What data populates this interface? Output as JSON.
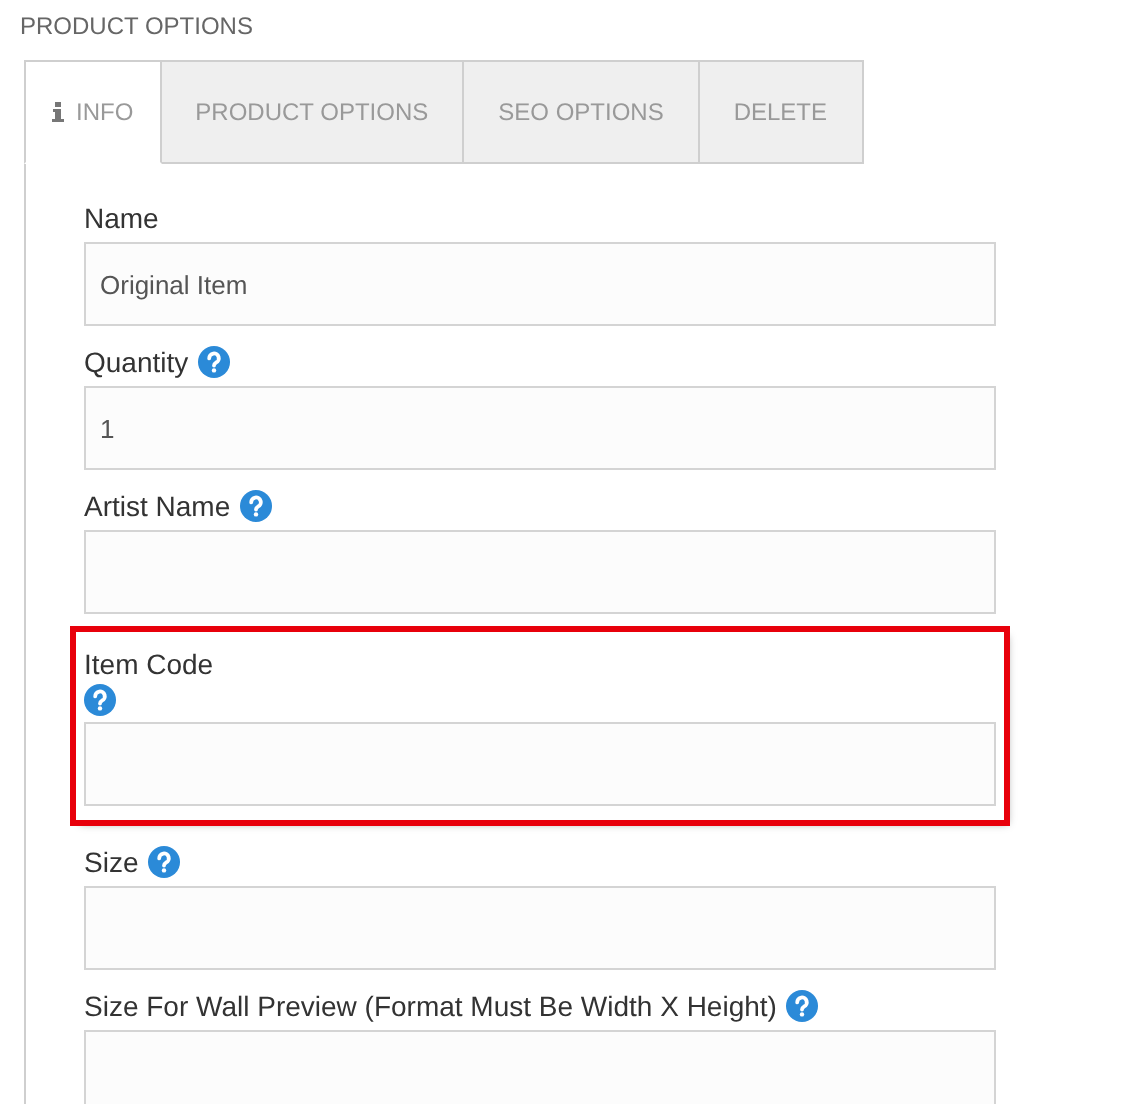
{
  "heading": "PRODUCT OPTIONS",
  "tabs": [
    {
      "label": "INFO",
      "selected": true,
      "has_icon": true
    },
    {
      "label": "PRODUCT OPTIONS",
      "selected": false
    },
    {
      "label": "SEO OPTIONS",
      "selected": false
    },
    {
      "label": "DELETE",
      "selected": false
    }
  ],
  "fields": [
    {
      "label": "Name",
      "value": "Original Item",
      "help": false,
      "highlighted": false
    },
    {
      "label": "Quantity",
      "value": "1",
      "help": true,
      "highlighted": false
    },
    {
      "label": "Artist Name",
      "help": true,
      "highlighted": false
    },
    {
      "label": "Item Code",
      "help": true,
      "highlighted": true
    },
    {
      "label": "Size",
      "help": true,
      "highlighted": false
    },
    {
      "label": "Size For Wall Preview (Format Must Be Width X Height)",
      "help": true,
      "highlighted": false
    }
  ]
}
